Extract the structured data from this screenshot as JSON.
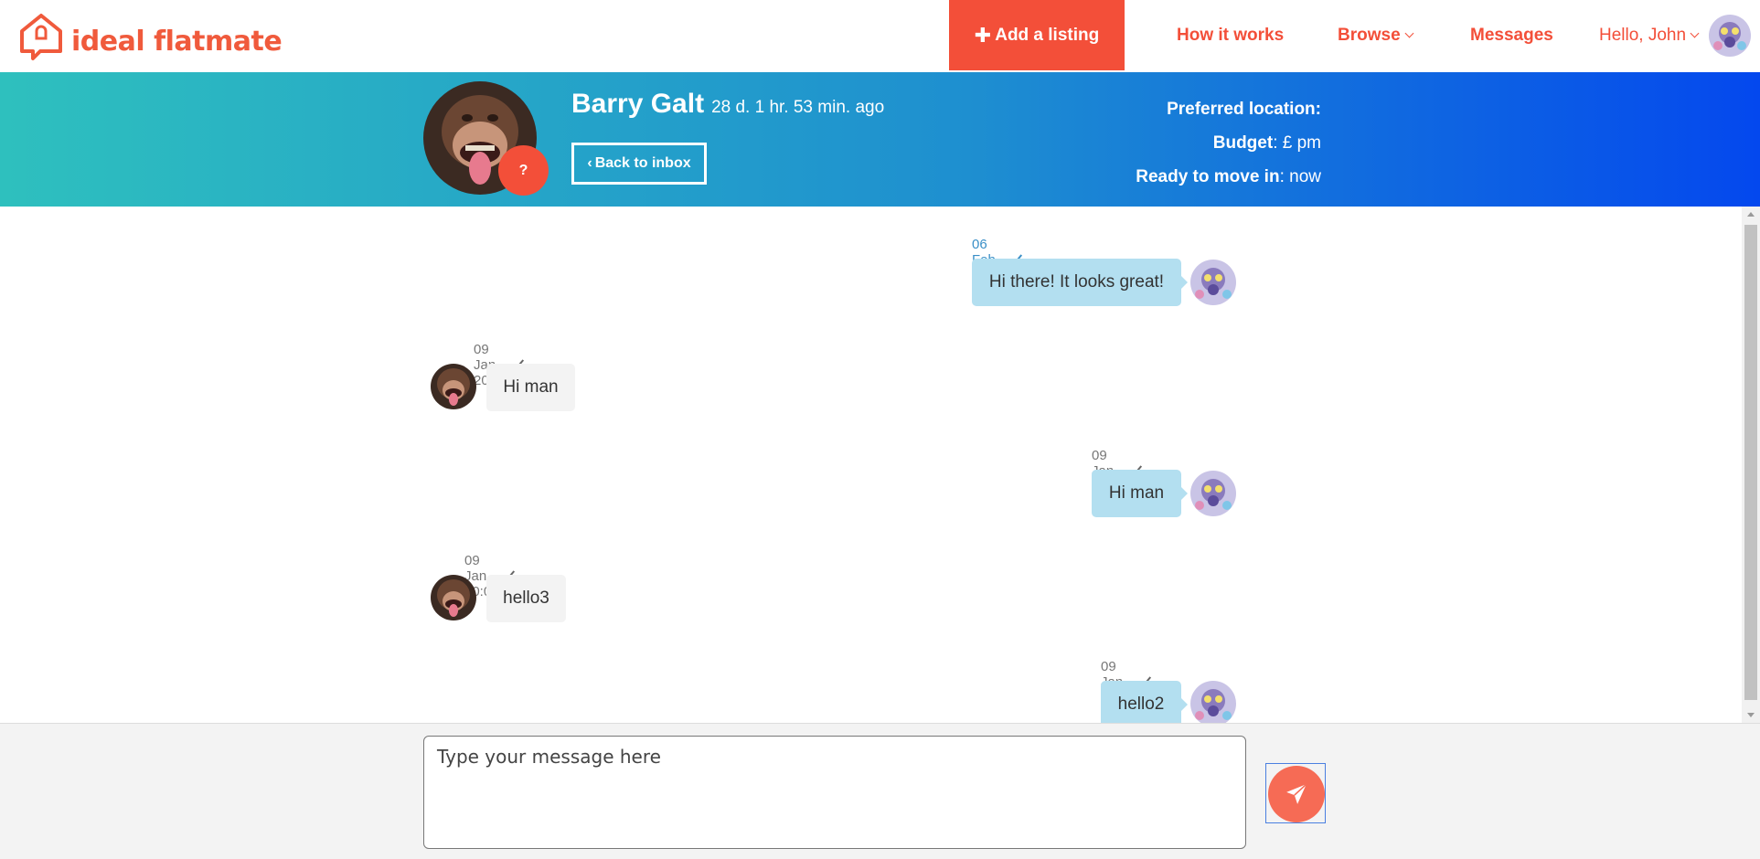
{
  "nav": {
    "logo_text": "ideal flatmate",
    "add_listing": "Add a listing",
    "add_icon": "plus-icon",
    "how_it_works": "How it works",
    "browse": "Browse",
    "messages": "Messages",
    "hello": "Hello, John",
    "brand_color": "#f34f39"
  },
  "profile": {
    "name": "Barry Galt",
    "last_seen": "28 d. 1 hr. 53 min. ago",
    "badge": "?",
    "back_label": "Back to inbox",
    "preferred_location_label": "Preferred location:",
    "preferred_location_value": "",
    "budget_label": "Budget",
    "budget_value": ": £ pm",
    "move_in_label": "Ready to move in",
    "move_in_value": ": now"
  },
  "messages": [
    {
      "time": "06 Feb 22:24",
      "text": "Hi there! It looks great!",
      "side": "mine"
    },
    {
      "time": "09 Jan 20:30",
      "text": "Hi man",
      "side": "theirs"
    },
    {
      "time": "09 Jan 20:27",
      "text": "Hi man",
      "side": "mine"
    },
    {
      "time": "09 Jan 20:04",
      "text": "hello3",
      "side": "theirs"
    },
    {
      "time": "09 Jan 19:58",
      "text": "hello2",
      "side": "mine"
    }
  ],
  "composer": {
    "placeholder": "Type your message here",
    "send_icon": "paper-plane-icon"
  },
  "colors": {
    "banner_start": "#2ec0be",
    "banner_end": "#0448ee",
    "mine_bubble": "#b3dff0",
    "theirs_bubble": "#f3f3f3",
    "send_button": "#f66b55"
  }
}
